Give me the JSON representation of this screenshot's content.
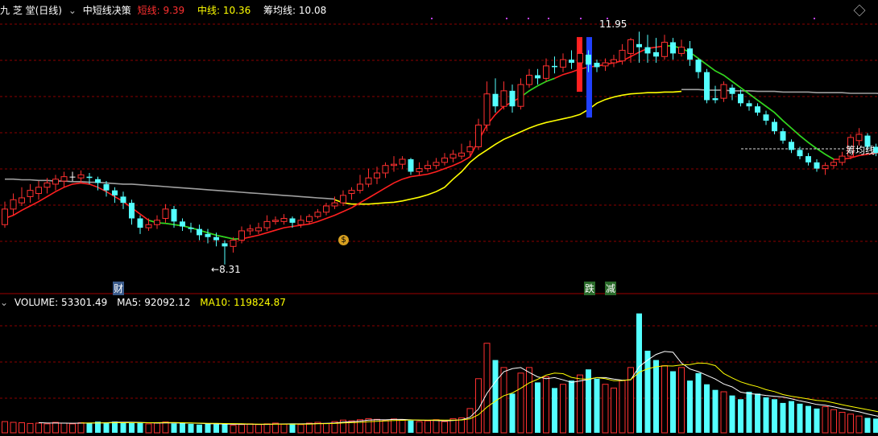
{
  "header": {
    "app": "九 芝 堂(日线)",
    "indicator": "中短线决策",
    "short_label": "短线:",
    "short_value": "9.39",
    "mid_label": "中线:",
    "mid_value": "10.36",
    "avg_label": "筹均线:",
    "avg_value": "10.08"
  },
  "volume_header": {
    "label": "VOLUME:",
    "value": "53301.49",
    "ma5_label": "MA5:",
    "ma5_value": "92092.12",
    "ma10_label": "MA10:",
    "ma10_value": "119824.87"
  },
  "annotations": {
    "high": "11.95",
    "low": "8.31",
    "avg_line": "筹均线",
    "cai": "财",
    "die": "跌",
    "jian": "减",
    "money": "$"
  },
  "colors": {
    "up": "#ff3030",
    "down": "#54ffff",
    "short_line": "#ff2020",
    "short_line_alt": "#20e020",
    "mid_line": "#ffff00",
    "avg_line": "#a0a0a0",
    "grid": "#8b0000",
    "white": "#ffffff",
    "purple": "#c040ff"
  },
  "chart_data": {
    "type": "candlestick",
    "candles": [
      [
        8.95,
        9.2,
        9.32,
        8.9
      ],
      [
        9.2,
        9.35,
        9.45,
        9.1
      ],
      [
        9.3,
        9.38,
        9.55,
        9.25
      ],
      [
        9.4,
        9.5,
        9.6,
        9.3
      ],
      [
        9.45,
        9.55,
        9.65,
        9.35
      ],
      [
        9.55,
        9.62,
        9.7,
        9.45
      ],
      [
        9.6,
        9.68,
        9.75,
        9.5
      ],
      [
        9.65,
        9.72,
        9.8,
        9.55
      ],
      [
        9.72,
        9.72,
        9.8,
        9.65
      ],
      [
        9.7,
        9.75,
        9.82,
        9.62
      ],
      [
        9.72,
        9.7,
        9.78,
        9.6
      ],
      [
        9.68,
        9.62,
        9.72,
        9.5
      ],
      [
        9.6,
        9.5,
        9.65,
        9.4
      ],
      [
        9.5,
        9.42,
        9.55,
        9.3
      ],
      [
        9.4,
        9.3,
        9.48,
        9.2
      ],
      [
        9.3,
        9.05,
        9.35,
        8.95
      ],
      [
        9.05,
        8.9,
        9.1,
        8.8
      ],
      [
        8.9,
        8.95,
        9.05,
        8.85
      ],
      [
        8.95,
        9.02,
        9.1,
        8.88
      ],
      [
        9.05,
        9.2,
        9.28,
        8.98
      ],
      [
        9.2,
        9.0,
        9.25,
        8.9
      ],
      [
        9.0,
        8.92,
        9.05,
        8.85
      ],
      [
        8.9,
        8.88,
        8.98,
        8.82
      ],
      [
        8.88,
        8.78,
        8.95,
        8.7
      ],
      [
        8.8,
        8.75,
        8.88,
        8.65
      ],
      [
        8.75,
        8.7,
        8.82,
        8.6
      ],
      [
        8.65,
        8.6,
        8.7,
        8.31
      ],
      [
        8.6,
        8.7,
        8.75,
        8.5
      ],
      [
        8.7,
        8.85,
        8.92,
        8.65
      ],
      [
        8.85,
        8.88,
        8.95,
        8.78
      ],
      [
        8.85,
        8.9,
        8.98,
        8.8
      ],
      [
        8.9,
        9.0,
        9.1,
        8.85
      ],
      [
        9.0,
        9.02,
        9.08,
        8.95
      ],
      [
        9.0,
        9.05,
        9.12,
        8.95
      ],
      [
        9.05,
        8.98,
        9.08,
        8.9
      ],
      [
        8.95,
        9.02,
        9.1,
        8.9
      ],
      [
        9.0,
        9.08,
        9.12,
        8.95
      ],
      [
        9.08,
        9.15,
        9.2,
        9.05
      ],
      [
        9.15,
        9.25,
        9.3,
        9.1
      ],
      [
        9.25,
        9.3,
        9.4,
        9.2
      ],
      [
        9.3,
        9.42,
        9.5,
        9.25
      ],
      [
        9.45,
        9.5,
        9.55,
        9.35
      ],
      [
        9.5,
        9.6,
        9.75,
        9.45
      ],
      [
        9.6,
        9.7,
        9.85,
        9.55
      ],
      [
        9.7,
        9.78,
        9.88,
        9.6
      ],
      [
        9.78,
        9.9,
        9.95,
        9.7
      ],
      [
        9.9,
        9.92,
        10.05,
        9.8
      ],
      [
        9.92,
        10.0,
        10.05,
        9.85
      ],
      [
        10.0,
        9.8,
        10.02,
        9.75
      ],
      [
        9.8,
        9.85,
        9.95,
        9.75
      ],
      [
        9.85,
        9.9,
        9.98,
        9.8
      ],
      [
        9.9,
        9.95,
        10.02,
        9.85
      ],
      [
        9.95,
        10.02,
        10.1,
        9.9
      ],
      [
        10.02,
        10.08,
        10.15,
        9.95
      ],
      [
        10.05,
        10.1,
        10.25,
        10.0
      ],
      [
        10.12,
        10.2,
        10.3,
        10.05
      ],
      [
        10.2,
        10.55,
        10.65,
        10.15
      ],
      [
        10.55,
        11.05,
        11.25,
        10.45
      ],
      [
        11.05,
        10.85,
        11.3,
        10.75
      ],
      [
        10.85,
        11.1,
        11.25,
        10.8
      ],
      [
        11.1,
        10.85,
        11.2,
        10.75
      ],
      [
        10.85,
        11.2,
        11.3,
        10.8
      ],
      [
        11.2,
        11.35,
        11.45,
        11.15
      ],
      [
        11.35,
        11.3,
        11.45,
        11.2
      ],
      [
        11.3,
        11.5,
        11.62,
        11.25
      ],
      [
        11.5,
        11.48,
        11.65,
        11.38
      ],
      [
        11.48,
        11.6,
        11.7,
        11.4
      ],
      [
        11.6,
        11.55,
        11.75,
        11.45
      ],
      [
        11.55,
        11.7,
        11.9,
        11.5
      ],
      [
        11.68,
        11.52,
        11.75,
        11.4
      ],
      [
        11.55,
        11.48,
        11.6,
        11.4
      ],
      [
        11.5,
        11.55,
        11.62,
        11.42
      ],
      [
        11.55,
        11.6,
        11.68,
        11.48
      ],
      [
        11.58,
        11.75,
        11.85,
        11.52
      ],
      [
        11.7,
        11.92,
        11.95,
        11.55
      ],
      [
        11.85,
        11.8,
        12.05,
        11.55
      ],
      [
        11.8,
        11.7,
        12.0,
        11.55
      ],
      [
        11.72,
        11.65,
        11.95,
        11.55
      ],
      [
        11.65,
        11.88,
        12.0,
        11.6
      ],
      [
        11.88,
        11.7,
        11.95,
        11.6
      ],
      [
        11.7,
        11.8,
        11.92,
        11.65
      ],
      [
        11.78,
        11.6,
        11.9,
        11.5
      ],
      [
        11.6,
        11.4,
        11.62,
        11.3
      ],
      [
        11.4,
        10.95,
        11.45,
        10.9
      ],
      [
        10.98,
        10.95,
        11.18,
        10.9
      ],
      [
        10.98,
        11.2,
        11.25,
        10.92
      ],
      [
        11.15,
        11.05,
        11.2,
        10.95
      ],
      [
        11.05,
        10.9,
        11.12,
        10.85
      ],
      [
        10.9,
        10.85,
        10.95,
        10.78
      ],
      [
        10.85,
        10.75,
        10.9,
        10.7
      ],
      [
        10.72,
        10.62,
        10.78,
        10.55
      ],
      [
        10.6,
        10.45,
        10.65,
        10.4
      ],
      [
        10.45,
        10.3,
        10.5,
        10.25
      ],
      [
        10.28,
        10.15,
        10.32,
        10.1
      ],
      [
        10.15,
        10.05,
        10.2,
        10.0
      ],
      [
        10.05,
        9.95,
        10.1,
        9.9
      ],
      [
        9.95,
        9.85,
        10.0,
        9.8
      ],
      [
        9.85,
        9.9,
        9.95,
        9.75
      ],
      [
        9.9,
        9.95,
        10.0,
        9.85
      ],
      [
        9.95,
        10.05,
        10.12,
        9.9
      ],
      [
        10.05,
        10.35,
        10.4,
        10.0
      ],
      [
        10.3,
        10.4,
        10.5,
        10.22
      ],
      [
        10.38,
        10.2,
        10.42,
        10.15
      ],
      [
        10.2,
        10.1,
        10.25,
        10.05
      ],
      [
        10.1,
        10.05,
        10.15,
        10.0
      ],
      [
        10.02,
        10.15,
        10.25,
        10.0
      ],
      [
        10.12,
        10.3,
        10.38,
        10.08
      ],
      [
        10.28,
        10.28,
        10.35,
        10.2
      ],
      [
        10.25,
        10.22,
        10.32,
        10.15
      ],
      [
        10.2,
        10.12,
        10.28,
        10.08
      ]
    ],
    "short_line": [
      9.05,
      9.1,
      9.18,
      9.25,
      9.32,
      9.4,
      9.48,
      9.55,
      9.6,
      9.62,
      9.6,
      9.55,
      9.48,
      9.4,
      9.32,
      9.22,
      9.12,
      9.02,
      8.98,
      8.97,
      8.95,
      8.93,
      8.9,
      8.86,
      8.82,
      8.78,
      8.75,
      8.72,
      8.72,
      8.75,
      8.78,
      8.82,
      8.86,
      8.9,
      8.92,
      8.94,
      8.96,
      9.0,
      9.05,
      9.1,
      9.16,
      9.22,
      9.3,
      9.38,
      9.46,
      9.54,
      9.62,
      9.68,
      9.72,
      9.74,
      9.76,
      9.8,
      9.85,
      9.9,
      9.96,
      10.04,
      10.3,
      10.55,
      10.72,
      10.85,
      10.92,
      11.0,
      11.1,
      11.18,
      11.25,
      11.3,
      11.36,
      11.4,
      11.45,
      11.48,
      11.5,
      11.52,
      11.55,
      11.58,
      11.65,
      11.72,
      11.78,
      11.8,
      11.82,
      11.82,
      11.78,
      11.72,
      11.62,
      11.52,
      11.42,
      11.35,
      11.25,
      11.15,
      11.05,
      10.95,
      10.85,
      10.75,
      10.62,
      10.5,
      10.38,
      10.27,
      10.17,
      10.08,
      10.0,
      10.0,
      10.02,
      10.06,
      10.08,
      10.1,
      10.11,
      10.12,
      10.15,
      10.18,
      10.2,
      10.2
    ],
    "short_line_green": [
      [
        17,
        28
      ],
      [
        61,
        65
      ],
      [
        78,
        98
      ],
      [
        104,
        105
      ],
      [
        107,
        109
      ]
    ],
    "mid_line": [
      null,
      null,
      null,
      null,
      null,
      null,
      null,
      null,
      null,
      null,
      null,
      null,
      null,
      null,
      null,
      null,
      null,
      null,
      null,
      null,
      null,
      null,
      null,
      null,
      null,
      null,
      null,
      null,
      null,
      null,
      null,
      null,
      null,
      null,
      null,
      null,
      null,
      null,
      null,
      9.35,
      9.3,
      9.28,
      9.28,
      9.28,
      9.29,
      9.3,
      9.31,
      9.33,
      9.36,
      9.39,
      9.43,
      9.48,
      9.55,
      9.68,
      9.8,
      9.95,
      10.06,
      10.15,
      10.24,
      10.32,
      10.38,
      10.44,
      10.5,
      10.55,
      10.59,
      10.62,
      10.65,
      10.68,
      10.72,
      10.8,
      10.9,
      10.96,
      11.0,
      11.03,
      11.05,
      11.06,
      11.07,
      11.07,
      11.08,
      11.08,
      11.09,
      11.09,
      11.1,
      11.1,
      11.1,
      11.1,
      11.1,
      11.1,
      11.1,
      11.1,
      11.1,
      11.1,
      11.1,
      11.1,
      11.1,
      11.1,
      11.1,
      11.1,
      11.1,
      11.1,
      11.1,
      11.1,
      11.1,
      11.1,
      11.1,
      11.1,
      11.1,
      11.1,
      11.1,
      11.1
    ],
    "mid_line_segment": [
      39,
      80
    ],
    "avg_line": [
      9.68,
      9.68,
      9.67,
      9.67,
      9.66,
      9.66,
      9.65,
      9.65,
      9.64,
      9.64,
      9.63,
      9.63,
      9.62,
      9.61,
      9.6,
      9.6,
      9.59,
      9.58,
      9.57,
      9.56,
      9.55,
      9.54,
      9.53,
      9.52,
      9.51,
      9.5,
      9.49,
      9.48,
      9.47,
      9.46,
      9.45,
      9.44,
      9.43,
      9.42,
      9.41,
      9.4,
      9.39,
      9.38,
      9.37,
      9.36,
      null,
      null,
      null,
      null,
      null,
      null,
      null,
      null,
      null,
      null,
      null,
      null,
      null,
      null,
      null,
      null,
      null,
      null,
      null,
      null,
      null,
      null,
      null,
      null,
      null,
      null,
      null,
      null,
      null,
      null,
      null,
      null,
      null,
      null,
      null,
      null,
      null,
      null,
      null,
      null,
      11.12,
      11.12,
      11.12,
      11.11,
      11.11,
      11.11,
      11.1,
      11.1,
      11.1,
      11.09,
      11.09,
      11.09,
      11.08,
      11.08,
      11.08,
      11.08,
      11.07,
      11.07,
      11.07,
      11.07,
      11.06,
      11.06,
      11.06,
      11.06,
      11.05,
      11.05,
      11.05,
      11.05,
      11.05,
      11.05
    ],
    "volume": [
      30,
      28,
      27,
      25,
      26,
      24,
      28,
      26,
      24,
      27,
      26,
      30,
      28,
      30,
      27,
      26,
      28,
      24,
      26,
      29,
      25,
      27,
      24,
      22,
      24,
      23,
      25,
      20,
      22,
      24,
      22,
      24,
      26,
      23,
      25,
      22,
      26,
      28,
      25,
      30,
      34,
      32,
      35,
      38,
      36,
      33,
      37,
      35,
      33,
      30,
      32,
      35,
      30,
      38,
      40,
      65,
      145,
      240,
      195,
      175,
      105,
      160,
      175,
      135,
      150,
      120,
      130,
      140,
      155,
      170,
      145,
      130,
      120,
      140,
      175,
      320,
      220,
      195,
      180,
      165,
      175,
      140,
      160,
      130,
      115,
      110,
      100,
      90,
      110,
      105,
      95,
      90,
      80,
      85,
      78,
      72,
      65,
      70,
      62,
      55,
      50,
      45,
      40,
      38,
      35,
      30,
      28,
      25
    ],
    "volume_ylim": [
      0,
      330
    ],
    "price_ylim": [
      8.1,
      12.3
    ],
    "xlabel": "",
    "ylabel": ""
  }
}
